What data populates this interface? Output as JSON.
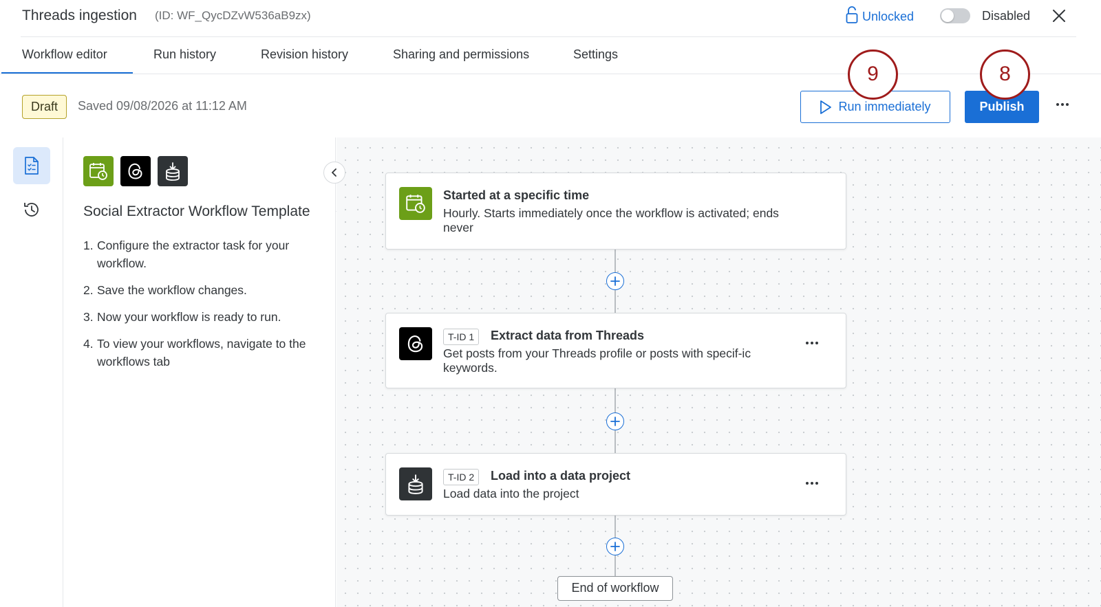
{
  "header": {
    "title": "Threads ingestion",
    "id_text": "(ID: WF_QycDZvW536aB9zx)",
    "lock_label": "Unlocked",
    "lock_icon": "unlock-icon",
    "toggle_state": "off",
    "toggle_label": "Disabled",
    "close_icon": "close-icon"
  },
  "tabs": [
    {
      "label": "Workflow editor",
      "active": true
    },
    {
      "label": "Run history"
    },
    {
      "label": "Revision history"
    },
    {
      "label": "Sharing and permissions"
    },
    {
      "label": "Settings"
    }
  ],
  "toolbar": {
    "status_badge": "Draft",
    "saved_text": "Saved 09/08/2026 at 11:12 AM",
    "run_label": "Run immediately",
    "publish_label": "Publish",
    "callout_run": "9",
    "callout_publish": "8"
  },
  "colors": {
    "accent": "#1a6fd6",
    "callout": "#9f1b1b",
    "draft_bg": "#fff9d6",
    "trigger_green": "#6c9f18"
  },
  "rail": {
    "items": [
      {
        "icon": "document-checklist-icon",
        "active": true
      },
      {
        "icon": "history-icon"
      }
    ]
  },
  "panel": {
    "icons": [
      "calendar-clock-icon",
      "threads-icon",
      "data-load-icon"
    ],
    "title": "Social Extractor Workflow Template",
    "steps": [
      {
        "num": "1.",
        "text": "Configure the extractor task for your workflow."
      },
      {
        "num": "2.",
        "text": "Save the workflow changes."
      },
      {
        "num": "3.",
        "text": "Now your workflow is ready to run."
      },
      {
        "num": "4.",
        "text": "To view your workflows, navigate to the workflows tab"
      }
    ]
  },
  "workflow": {
    "trigger": {
      "icon": "calendar-clock-icon",
      "title": "Started at a specific time",
      "description": "Hourly. Starts immediately once the workflow is activated; ends never"
    },
    "tasks": [
      {
        "tid": "T-ID 1",
        "icon": "threads-icon",
        "title": "Extract data from Threads",
        "description": "Get posts from your Threads profile or posts with specif-ic keywords."
      },
      {
        "tid": "T-ID 2",
        "icon": "data-load-icon",
        "title": "Load into a data project",
        "description": "Load data into the project"
      }
    ],
    "end_label": "End of workflow"
  }
}
